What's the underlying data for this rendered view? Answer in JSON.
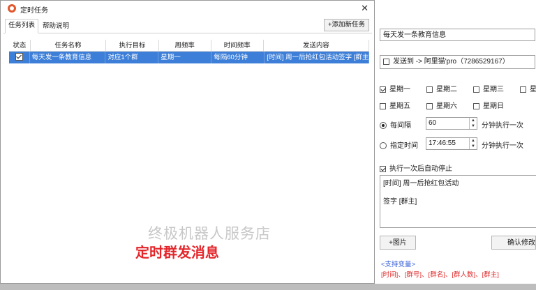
{
  "dialog": {
    "title": "定时任务",
    "tabs": [
      {
        "label": "任务列表",
        "active": true
      },
      {
        "label": "帮助说明",
        "active": false
      }
    ],
    "add_button": "+添加新任务",
    "table": {
      "headers": [
        "状态",
        "任务名称",
        "执行目标",
        "周频率",
        "时间频率",
        "发送内容"
      ],
      "rows": [
        {
          "checked": true,
          "name": "每天发一条教育信息",
          "target": "对应1个群",
          "week": "星期一",
          "interval": "每隔60分钟",
          "content": "[时间] 周一后抢红包活动签字 [群主]"
        }
      ]
    },
    "watermark": "终极机器人服务店",
    "caption": "定时群发消息"
  },
  "panel": {
    "task_name": "每天发一条教育信息",
    "send_to": {
      "checked": false,
      "label": "发送到 -> 阿里猫'pro（7286529167）"
    },
    "weekdays": [
      {
        "label": "星期一",
        "checked": true
      },
      {
        "label": "星期二",
        "checked": false
      },
      {
        "label": "星期三",
        "checked": false
      },
      {
        "label": "星",
        "checked": false
      },
      {
        "label": "星期五",
        "checked": false
      },
      {
        "label": "星期六",
        "checked": false
      },
      {
        "label": "星期日",
        "checked": false
      }
    ],
    "interval": {
      "label": "每间隔",
      "value": "60",
      "suffix": "分钟执行一次",
      "selected": true
    },
    "fixed_time": {
      "label": "指定时间",
      "value": "17:46:55",
      "suffix": "分钟执行一次",
      "selected": false
    },
    "auto_stop": {
      "label": "执行一次后自动停止",
      "checked": true
    },
    "content_lines": [
      "[时间] 周一后抢红包活动",
      "签字 [群主]"
    ],
    "image_button": "+图片",
    "confirm_button": "确认修改",
    "vars_link": "<支持变量>",
    "vars_list": "[时间]、[群号]、[群名]、[群人数]、[群主]"
  }
}
